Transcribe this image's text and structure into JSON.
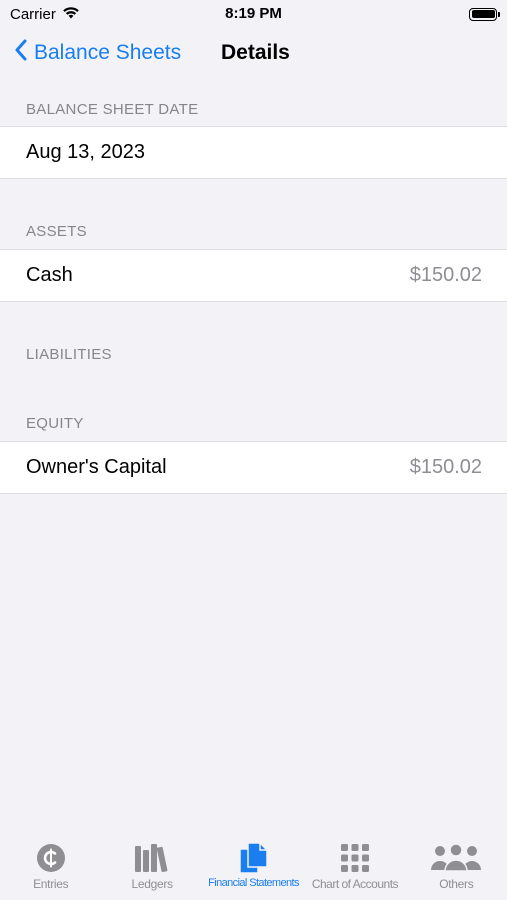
{
  "status_bar": {
    "carrier": "Carrier",
    "time": "8:19 PM"
  },
  "nav": {
    "back_label": "Balance Sheets",
    "title": "Details"
  },
  "sections": {
    "date": {
      "header": "BALANCE SHEET DATE",
      "value": "Aug 13, 2023"
    },
    "assets": {
      "header": "ASSETS",
      "rows": [
        {
          "label": "Cash",
          "value": "$150.02"
        }
      ]
    },
    "liabilities": {
      "header": "LIABILITIES"
    },
    "equity": {
      "header": "EQUITY",
      "rows": [
        {
          "label": "Owner's Capital",
          "value": "$150.02"
        }
      ]
    }
  },
  "tabs": [
    {
      "label": "Entries",
      "icon": "cent-circle-icon",
      "active": false
    },
    {
      "label": "Ledgers",
      "icon": "books-icon",
      "active": false
    },
    {
      "label": "Financial Statements",
      "icon": "documents-icon",
      "active": true
    },
    {
      "label": "Chart of Accounts",
      "icon": "grid-icon",
      "active": false
    },
    {
      "label": "Others",
      "icon": "people-icon",
      "active": false
    }
  ],
  "colors": {
    "accent": "#1a7ef0",
    "background": "#f2f2f7",
    "secondary_text": "#8e8e93"
  }
}
